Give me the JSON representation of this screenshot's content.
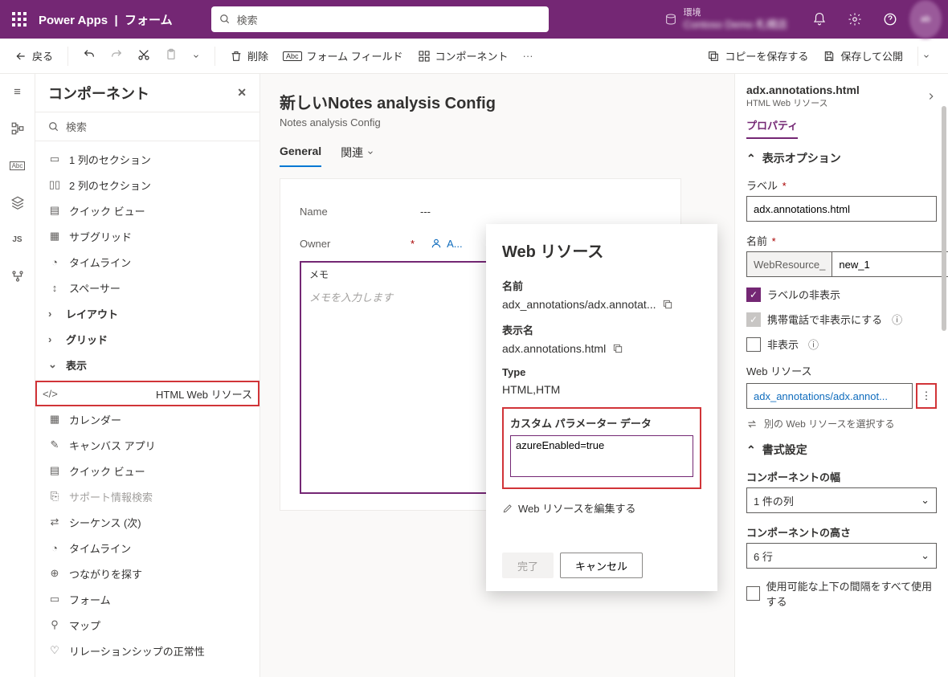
{
  "topbar": {
    "brand": "Power Apps",
    "context": "フォーム",
    "search_placeholder": "検索",
    "env_label": "環境",
    "env_name": "Contoso Demo 札幌店"
  },
  "cmdbar": {
    "back": "戻る",
    "delete": "削除",
    "form_field": "フォーム フィールド",
    "component": "コンポーネント",
    "save_copy": "コピーを保存する",
    "save_publish": "保存して公開"
  },
  "leftpanel": {
    "title": "コンポーネント",
    "search_placeholder": "検索",
    "items": [
      {
        "icon": "▭",
        "label": "1 列のセクション"
      },
      {
        "icon": "▭▭",
        "label": "2 列のセクション"
      },
      {
        "icon": "▤",
        "label": "クイック ビュー"
      },
      {
        "icon": "▦",
        "label": "サブグリッド"
      },
      {
        "icon": "◐",
        "label": "タイムライン"
      },
      {
        "icon": "↕",
        "label": "スペーサー"
      }
    ],
    "groups": [
      {
        "label": "レイアウト"
      },
      {
        "label": "グリッド"
      },
      {
        "label": "表示",
        "open": true
      }
    ],
    "display_items": [
      {
        "icon": "</>",
        "label": "HTML Web リソース",
        "selected": true
      },
      {
        "icon": "▦",
        "label": "カレンダー"
      },
      {
        "icon": "✎",
        "label": "キャンバス アプリ"
      },
      {
        "icon": "▤",
        "label": "クイック ビュー"
      },
      {
        "icon": "⎘",
        "label": "サポート情報検索",
        "disabled": true
      },
      {
        "icon": "⇄",
        "label": "シーケンス (次)"
      },
      {
        "icon": "◐",
        "label": "タイムライン"
      },
      {
        "icon": "⊕",
        "label": "つながりを探す"
      },
      {
        "icon": "▭",
        "label": "フォーム"
      },
      {
        "icon": "⚲",
        "label": "マップ"
      },
      {
        "icon": "♡",
        "label": "リレーションシップの正常性"
      }
    ]
  },
  "canvas": {
    "title": "新しいNotes analysis Config",
    "subtitle": "Notes analysis Config",
    "tabs": {
      "general": "General",
      "related": "関連"
    },
    "name_label": "Name",
    "name_value": "---",
    "owner_label": "Owner",
    "owner_value": "A...",
    "memo_label": "メモ",
    "memo_placeholder": "メモを入力します"
  },
  "popup": {
    "title": "Web リソース",
    "name_label": "名前",
    "name_value": "adx_annotations/adx.annotat...",
    "display_label": "表示名",
    "display_value": "adx.annotations.html",
    "type_label": "Type",
    "type_value": "HTML,HTM",
    "custom_label": "カスタム パラメーター データ",
    "custom_value": "azureEnabled=true",
    "edit": "Web リソースを編集する",
    "done": "完了",
    "cancel": "キャンセル"
  },
  "rpanel": {
    "title": "adx.annotations.html",
    "subtitle": "HTML Web リソース",
    "tab": "プロパティ",
    "section_display": "表示オプション",
    "label_label": "ラベル",
    "label_value": "adx.annotations.html",
    "name_label": "名前",
    "name_prefix": "WebResource_",
    "name_value": "new_1",
    "hide_label": "ラベルの非表示",
    "hide_phone": "携帯電話で非表示にする",
    "hide": "非表示",
    "wr_label": "Web リソース",
    "wr_value": "adx_annotations/adx.annot...",
    "wr_select": "別の Web リソースを選択する",
    "section_format": "書式設定",
    "width_label": "コンポーネントの幅",
    "width_value": "1 件の列",
    "height_label": "コンポーネントの高さ",
    "height_value": "6 行",
    "use_space": "使用可能な上下の間隔をすべて使用する"
  }
}
